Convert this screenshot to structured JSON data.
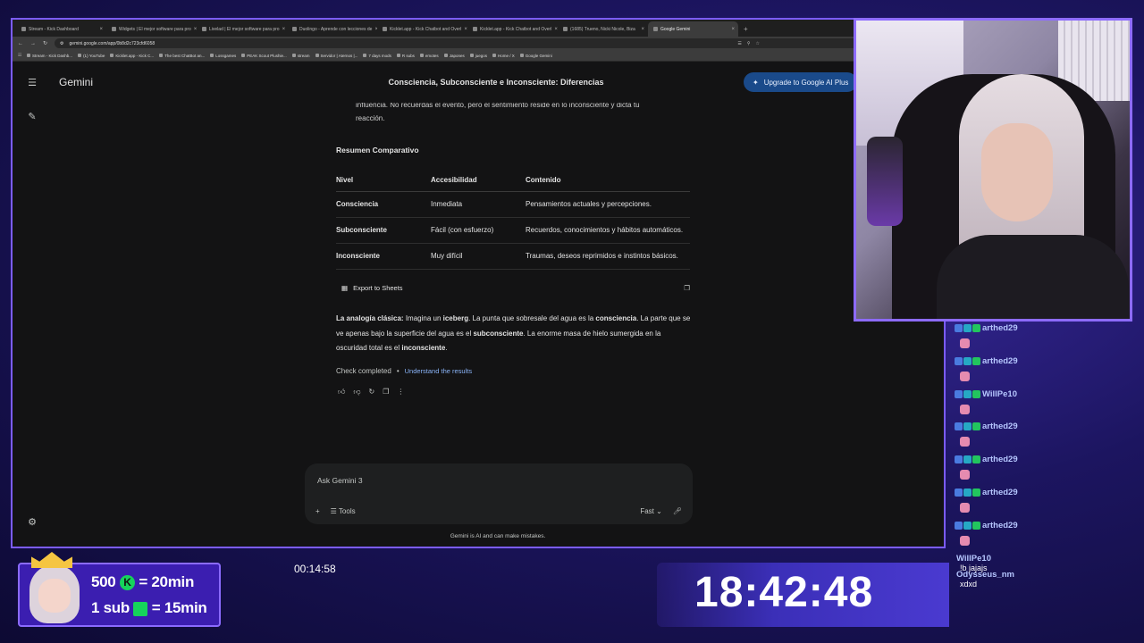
{
  "browser": {
    "tabs": [
      {
        "label": "Stream - Kick Dashboard",
        "active": false
      },
      {
        "label": "Widgets | El mejor software para pro",
        "active": false
      },
      {
        "label": "Livelad | El mejor software para pro",
        "active": false
      },
      {
        "label": "Duolingo - Aprende con lecciones de",
        "active": false
      },
      {
        "label": "Kicklet.app - Kick Chatbot and Overl",
        "active": false
      },
      {
        "label": "Kicklet.app - Kick Chatbot and Overl",
        "active": false
      },
      {
        "label": "(1685) Trueno, Nicki Nicole, Biza",
        "active": false
      },
      {
        "label": "Google Gemini",
        "active": true
      }
    ],
    "url": "gemini.google.com/app/0b8d2c723cfd6058",
    "bookmarks": [
      "Stream - Kick Dashb...",
      "(1) YouTube",
      "Kicklet.app - Kick C...",
      "The best ChatBot an...",
      "Lossgames",
      "PEAK Scout Plushie...",
      "stream",
      "Servidor | Aternos |...",
      "7 days mods",
      "R subs",
      "emotes",
      "Japones",
      "juegos",
      "Home / X",
      "Google Gemini"
    ]
  },
  "gemini": {
    "brand": "Gemini",
    "conversation_title": "Consciencia, Subconsciente e Inconsciente: Diferencias",
    "upgrade_label": "Upgrade to Google AI Plus",
    "cut_line_1": "influencia. No recuerdas el evento, pero el sentimiento reside en lo inconsciente y dicta tu",
    "cut_line_2": "reacción.",
    "summary_heading": "Resumen Comparativo",
    "table": {
      "headers": [
        "Nivel",
        "Accesibilidad",
        "Contenido"
      ],
      "rows": [
        [
          "Consciencia",
          "Inmediata",
          "Pensamientos actuales y percepciones."
        ],
        [
          "Subconsciente",
          "Fácil (con esfuerzo)",
          "Recuerdos, conocimientos y hábitos automáticos."
        ],
        [
          "Inconsciente",
          "Muy difícil",
          "Traumas, deseos reprimidos e instintos básicos."
        ]
      ]
    },
    "export_label": "Export to Sheets",
    "analogy": {
      "lead": "La analogía clásica:",
      "t1": " Imagina un ",
      "b1": "iceberg",
      "t2": ". La punta que sobresale del agua es la ",
      "b2": "consciencia",
      "t3": ". La parte que se ve apenas bajo la superficie del agua es el ",
      "b3": "subconsciente",
      "t4": ". La enorme masa de hielo sumergida en la oscuridad total es el ",
      "b4": "inconsciente",
      "t5": "."
    },
    "check_text": "Check completed",
    "check_sep": "•",
    "understand_link": "Understand the results",
    "input_placeholder": "Ask Gemini 3",
    "tools_label": "Tools",
    "mode_label": "Fast",
    "disclaimer": "Gemini is AI and can make mistakes."
  },
  "chat_overlay": {
    "messages": [
      {
        "user": "arthed29",
        "text": ""
      },
      {
        "user": "arthed29",
        "text": ""
      },
      {
        "user": "WillPe10",
        "text": ""
      },
      {
        "user": "arthed29",
        "text": ""
      },
      {
        "user": "arthed29",
        "text": ""
      },
      {
        "user": "arthed29",
        "text": ""
      },
      {
        "user": "arthed29",
        "text": ""
      },
      {
        "user": "WillPe10",
        "text": "!b jajajs"
      },
      {
        "user": "Odysseus_nm",
        "text": "xdxd"
      }
    ]
  },
  "goals": {
    "line1_amount": "500",
    "line1_rhs": "= 20min",
    "line2_amount": "1 sub",
    "line2_rhs": "= 15min"
  },
  "timer": "00:14:58",
  "clock": "18:42:48",
  "colors": {
    "accent_purple": "#8b6bff",
    "kick_green": "#16d35b",
    "gemini_link": "#8ab4f8"
  }
}
